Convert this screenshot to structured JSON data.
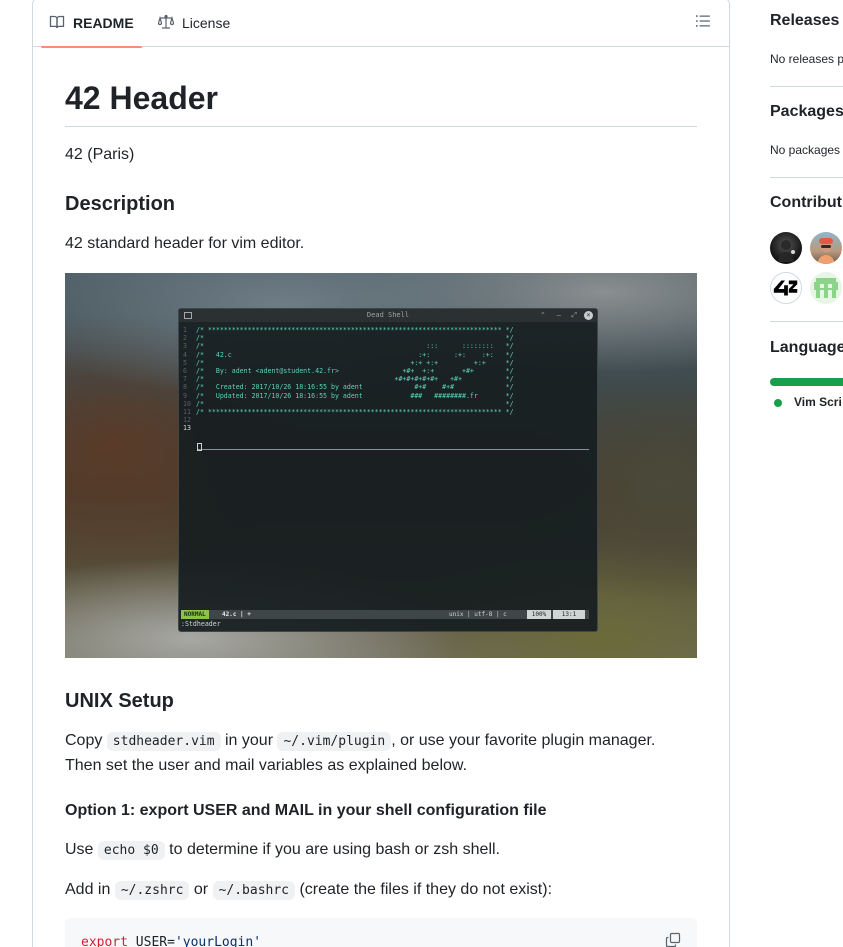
{
  "tabs": [
    {
      "label": "README",
      "icon": "book-icon",
      "active": true
    },
    {
      "label": "License",
      "icon": "law-icon",
      "active": false
    }
  ],
  "toc_icon": "list-unordered-icon",
  "readme": {
    "title": "42 Header",
    "subtitle": "42 (Paris)",
    "description_heading": "Description",
    "description_text": "42 standard header for vim editor.",
    "screenshot": {
      "window_title": "Dead Shell",
      "lines": [
        "/* ************************************************************************** */",
        "/*                                                                            */",
        "/*                                                        :::      ::::::::   */",
        "/*   42.c                                               :+:      :+:    :+:   */",
        "/*                                                    +:+ +:+         +:+     */",
        "/*   By: adent <adent@student.42.fr>                +#+  +:+       +#+        */",
        "/*                                                +#+#+#+#+#+   +#+           */",
        "/*   Created: 2017/10/26 18:16:55 by adent             #+#    #+#             */",
        "/*   Updated: 2017/10/26 18:16:55 by adent            ###   ########.fr       */",
        "/*                                                                            */",
        "/* ************************************************************************** */",
        "",
        ""
      ],
      "line_numbers": [
        "1",
        "2",
        "3",
        "4",
        "5",
        "6",
        "7",
        "8",
        "9",
        "10",
        "11",
        "12",
        "13"
      ],
      "mode": "NORMAL",
      "file": "42.c | +",
      "encoding": "unix | utf-8 | c",
      "percent": "100%",
      "position": "13:1",
      "command": ":Stdheader"
    },
    "unix_heading": "UNIX Setup",
    "unix_p1_a": "Copy ",
    "unix_p1_code1": "stdheader.vim",
    "unix_p1_b": " in your ",
    "unix_p1_code2": "~/.vim/plugin",
    "unix_p1_c": ", or use your favorite plugin manager.",
    "unix_p1_d": "Then set the user and mail variables as explained below.",
    "option1_heading": "Option 1: export USER and MAIL in your shell configuration file",
    "use_a": "Use ",
    "use_code": "echo $0",
    "use_b": " to determine if you are using bash or zsh shell.",
    "add_a": "Add in ",
    "add_code1": "~/.zshrc",
    "add_b": " or ",
    "add_code2": "~/.bashrc",
    "add_c": " (create the files if they do not exist):",
    "code_kw": "export",
    "code_var": " USER=",
    "code_str": "'yourLogin'",
    "copy_icon": "copy-icon"
  },
  "sidebar": {
    "releases_heading": "Releases",
    "releases_text": "No releases p",
    "packages_heading": "Packages",
    "packages_text": "No packages",
    "contributors_heading": "Contribut",
    "languages_heading": "Language",
    "language_name": "Vim Scri",
    "language_color": "#199f4b"
  },
  "colors": {
    "accent_underline": "#fd8c73",
    "border": "#d1d9e0"
  }
}
